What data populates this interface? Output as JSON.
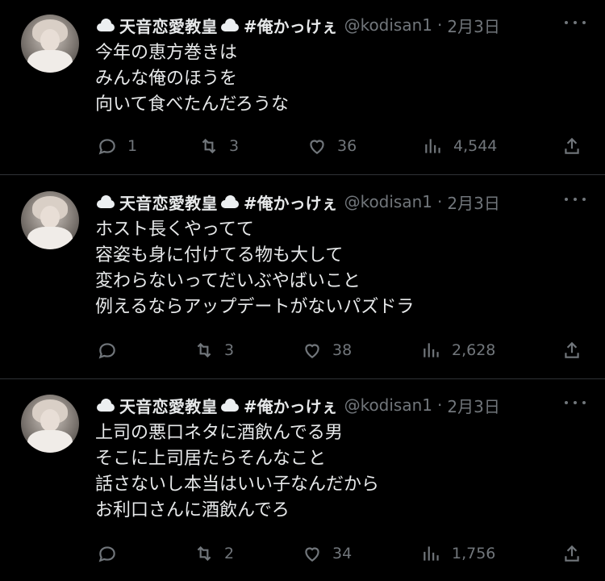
{
  "tweets": [
    {
      "display_name_part1": "天音恋愛教皇",
      "display_name_part2": "#俺かっけぇ",
      "handle": "@kodisan1",
      "separator": "·",
      "date": "2月3日",
      "lines": [
        "今年の恵方巻きは",
        "みんな俺のほうを",
        "向いて食べたんだろうな"
      ],
      "replies": "1",
      "retweets": "3",
      "likes": "36",
      "views": "4,544"
    },
    {
      "display_name_part1": "天音恋愛教皇",
      "display_name_part2": "#俺かっけぇ",
      "handle": "@kodisan1",
      "separator": "·",
      "date": "2月3日",
      "lines": [
        "ホスト長くやってて",
        "容姿も身に付けてる物も大して",
        "変わらないってだいぶやばいこと",
        "例えるならアップデートがないパズドラ"
      ],
      "replies": "",
      "retweets": "3",
      "likes": "38",
      "views": "2,628"
    },
    {
      "display_name_part1": "天音恋愛教皇",
      "display_name_part2": "#俺かっけぇ",
      "handle": "@kodisan1",
      "separator": "·",
      "date": "2月3日",
      "lines": [
        "上司の悪口ネタに酒飲んでる男",
        "そこに上司居たらそんなこと",
        "話さないし本当はいい子なんだから",
        "お利口さんに酒飲んでろ"
      ],
      "replies": "",
      "retweets": "2",
      "likes": "34",
      "views": "1,756"
    }
  ],
  "icons": {
    "name_emoji": "cloud-icon",
    "reply": "reply-icon",
    "retweet": "retweet-icon",
    "like": "heart-icon",
    "views": "views-icon",
    "share": "share-icon",
    "more": "more-icon"
  },
  "colors": {
    "background": "#000000",
    "text": "#e7e9ea",
    "secondary": "#71767b",
    "divider": "#2f3336"
  }
}
